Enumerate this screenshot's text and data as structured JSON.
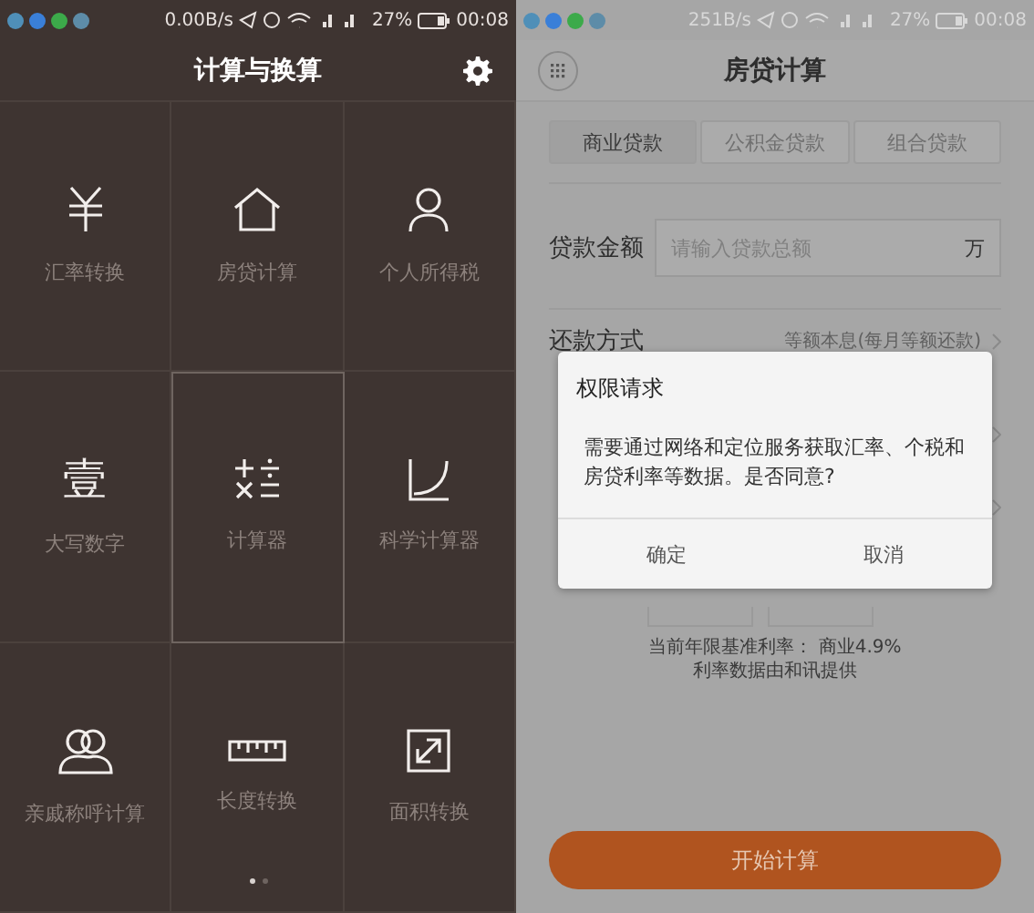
{
  "left_screen": {
    "status_bar": {
      "speed": "0.00B/s",
      "battery": "27%",
      "time": "00:08"
    },
    "title": "计算与换算",
    "tools": [
      {
        "label": "汇率转换",
        "kind": "yen",
        "selected": false
      },
      {
        "label": "房贷计算",
        "kind": "house",
        "selected": false
      },
      {
        "label": "个人所得税",
        "kind": "person",
        "selected": false
      },
      {
        "label": "大写数字",
        "kind": "glyph",
        "glyph": "壹",
        "selected": false
      },
      {
        "label": "计算器",
        "kind": "calc",
        "selected": true
      },
      {
        "label": "科学计算器",
        "kind": "curve",
        "selected": false
      },
      {
        "label": "亲戚称呼计算",
        "kind": "people",
        "selected": false
      },
      {
        "label": "长度转换",
        "kind": "ruler",
        "selected": false
      },
      {
        "label": "面积转换",
        "kind": "resize",
        "selected": false
      }
    ],
    "pages": [
      {
        "selected": true
      },
      {
        "selected": false
      }
    ]
  },
  "right_screen": {
    "status_bar": {
      "speed": "251B/s",
      "battery": "27%",
      "time": "00:08"
    },
    "title": "房贷计算",
    "loan_tabs": [
      {
        "label": "商业贷款",
        "selected": true
      },
      {
        "label": "公积金贷款",
        "selected": false
      },
      {
        "label": "组合贷款",
        "selected": false
      }
    ],
    "amount": {
      "label": "贷款金额",
      "placeholder": "请输入贷款总额",
      "unit": "万"
    },
    "repayment": {
      "label": "还款方式",
      "value": "等额本息(每月等额还款)"
    },
    "rate_note": [
      "当前年限基准利率： 商业4.9%",
      "利率数据由和讯提供"
    ],
    "start_button": "开始计算",
    "dialog": {
      "title": "权限请求",
      "message": "需要通过网络和定位服务获取汇率、个税和房贷利率等数据。是否同意?",
      "buttons": [
        "确定",
        "取消"
      ]
    }
  }
}
